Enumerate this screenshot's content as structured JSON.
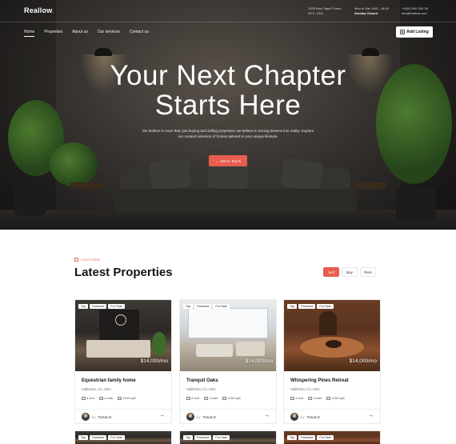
{
  "brand": {
    "name": "Reallow",
    "dot": "."
  },
  "topbar": {
    "address": [
      "1205 New Taipei Tower,",
      "NYC, USA"
    ],
    "hours": [
      "Mon to Sat: 8:00 - 18:00",
      "Sunday Closed"
    ],
    "contact": [
      "+1(00) 000 209 38",
      "info@reallow.com"
    ]
  },
  "nav": {
    "items": [
      "Home",
      "Properties",
      "About us",
      "Our services",
      "Contact us"
    ],
    "active": "Home",
    "cta": "Add Listing"
  },
  "hero": {
    "title_line1": "Your Next Chapter",
    "title_line2": "Starts Here",
    "subtitle": "We believe in more than just buying and selling properties; we believe in turning dreams into reality. Explore our curated selection of homes tailored to your unique lifestyle.",
    "cta": "Get In Touch"
  },
  "section": {
    "eyebrow": "FEATURED",
    "title": "Latest Properties",
    "filters": [
      "Sell",
      "Buy",
      "Rent"
    ],
    "active_filter": "Sell"
  },
  "cards": [
    {
      "tags": [
        "Top",
        "Featured",
        "For Sale"
      ],
      "price": "$14,000/mo",
      "title": "Equestrian family home",
      "location": "California, CA, USA",
      "beds": "3 bed",
      "baths": "4 bath",
      "area": "1200 sqft",
      "by": "by",
      "agent": "Tomas D."
    },
    {
      "tags": [
        "Top",
        "Featured",
        "For Sale"
      ],
      "price": "$14,000/mo",
      "title": "Tranquil Oaks",
      "location": "California, CA, USA",
      "beds": "2 bed",
      "baths": "1 bath",
      "area": "1200 sqft",
      "by": "by",
      "agent": "Tomas D."
    },
    {
      "tags": [
        "Top",
        "Featured",
        "For Sale"
      ],
      "price": "$14,000/mo",
      "title": "Whispering Pines Retreat",
      "location": "California, CA, USA",
      "beds": "1 bed",
      "baths": "4 bath",
      "area": "1200 sqft",
      "by": "by",
      "agent": "Tomas D."
    }
  ],
  "bottom_cards": [
    {
      "tags": [
        "Top",
        "Featured",
        "For Sale"
      ]
    },
    {
      "tags": [
        "Top",
        "Featured",
        "For Sale"
      ]
    },
    {
      "tags": [
        "Top",
        "Featured",
        "For Sale"
      ]
    }
  ],
  "icons": {
    "add_listing": "plus-box-icon",
    "cta": "arrow-right-icon",
    "beds": "bed-icon",
    "baths": "bath-icon",
    "area": "area-icon",
    "card_link": "arrow-right-icon"
  },
  "colors": {
    "accent": "#e85d4f",
    "dark": "#151515"
  }
}
